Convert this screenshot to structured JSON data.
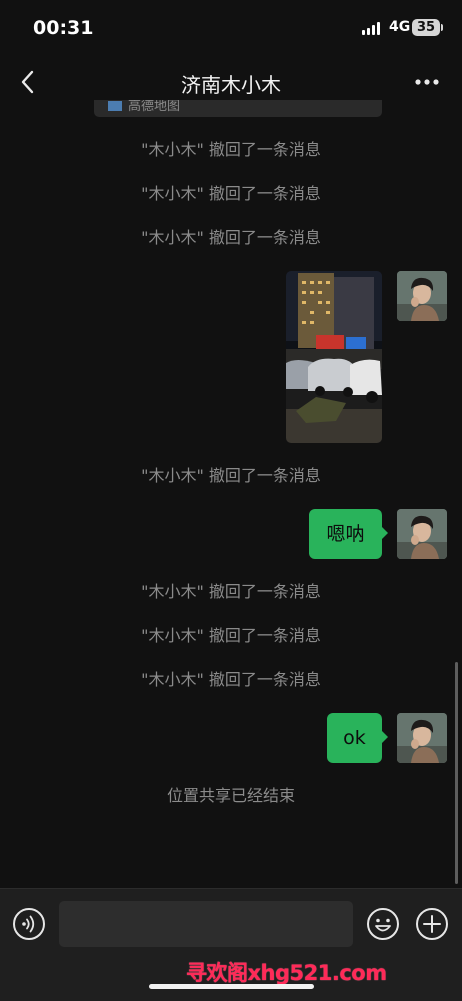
{
  "status_bar": {
    "time": "00:31",
    "network": "4G",
    "battery": "35"
  },
  "nav": {
    "title": "济南木小木",
    "back_icon": "chevron-left-icon",
    "more_icon": "more-dots-icon"
  },
  "messages": {
    "partial_card_label": "高德地图",
    "recall_1": "\"木小木\" 撤回了一条消息",
    "recall_2": "\"木小木\" 撤回了一条消息",
    "recall_3": "\"木小木\" 撤回了一条消息",
    "recall_4": "\"木小木\" 撤回了一条消息",
    "recall_5": "\"木小木\" 撤回了一条消息",
    "recall_6": "\"木小木\" 撤回了一条消息",
    "recall_7": "\"木小木\" 撤回了一条消息",
    "bubble_1": "嗯呐",
    "bubble_2": "ok",
    "location_end": "位置共享已经结束"
  },
  "input_bar": {
    "value": "",
    "placeholder": "",
    "voice_icon": "voice-icon",
    "emoji_icon": "emoji-icon",
    "plus_icon": "plus-icon"
  },
  "watermark": "寻欢阁xhg521.com",
  "colors": {
    "background": "#111111",
    "bubble_green": "#29b35b",
    "system_text": "#8b8b8b",
    "input_bar": "#1f1f1f",
    "watermark": "#ff2a58"
  }
}
